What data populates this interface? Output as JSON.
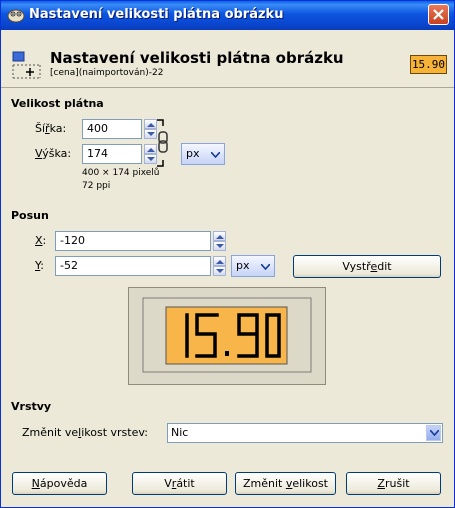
{
  "window": {
    "title": "Nastavení velikosti plátna obrázku"
  },
  "header": {
    "title": "Nastavení velikosti plátna obrázku",
    "subtitle": "[cena](naimportován)-22",
    "thumbnail_text": "15.90"
  },
  "canvas_size": {
    "section_label": "Velikost plátna",
    "width_label_pre": "Ší",
    "width_label_ul": "ř",
    "width_label_post": "ka:",
    "width_value": "400",
    "height_label_pre": "",
    "height_label_ul": "V",
    "height_label_post": "ýška:",
    "height_value": "174",
    "unit": "px",
    "info_size": "400 × 174 pixelů",
    "info_res": "72 ppi"
  },
  "offset": {
    "section_label": "Posun",
    "x_label": "X",
    "x_value": "-120",
    "y_label": "Y",
    "y_value": "-52",
    "unit": "px",
    "center_button_pre": "Vystř",
    "center_button_ul": "e",
    "center_button_post": "dit"
  },
  "preview": {
    "display_text": "15.90",
    "bg_color": "#f7b54a"
  },
  "layers": {
    "section_label": "Vrstvy",
    "resize_label_pre": "Změnit ve",
    "resize_label_ul": "l",
    "resize_label_post": "ikost vrstev:",
    "resize_value": "Nic"
  },
  "buttons": {
    "help_pre": "",
    "help_ul": "N",
    "help_post": "ápověda",
    "reset_pre": "V",
    "reset_ul": "r",
    "reset_post": "átit",
    "resize_pre": "Změnit ",
    "resize_ul": "v",
    "resize_post": "elikost",
    "cancel_pre": "",
    "cancel_ul": "Z",
    "cancel_post": "rušit"
  },
  "colors": {
    "titlebar": "#0a46cf",
    "face": "#ece9d8",
    "accent": "#f7b54a"
  }
}
